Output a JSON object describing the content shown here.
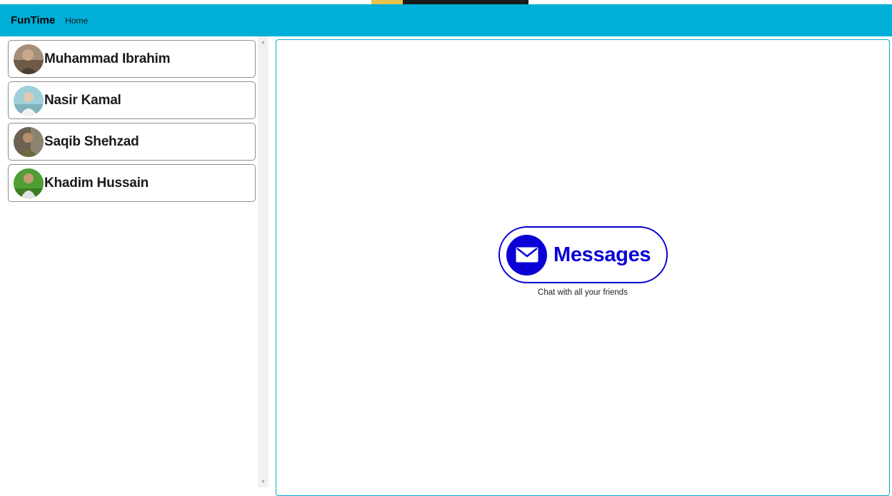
{
  "app": {
    "brand": "FunTime",
    "nav_home": "Home"
  },
  "contacts": [
    {
      "name": "Muhammad Ibrahim",
      "avatar_colors": [
        "#7b6a5a",
        "#c9b7a3"
      ]
    },
    {
      "name": "Nasir Kamal",
      "avatar_colors": [
        "#8fc3cf",
        "#e9eef0"
      ]
    },
    {
      "name": "Saqib Shehzad",
      "avatar_colors": [
        "#5a5040",
        "#b2a58a"
      ]
    },
    {
      "name": "Khadim Hussain",
      "avatar_colors": [
        "#3f8f2a",
        "#c8e0b6"
      ]
    }
  ],
  "main": {
    "logo_text": "Messages",
    "logo_icon": "envelope-icon",
    "subtitle": "Chat with all your friends"
  },
  "colors": {
    "navbar": "#00afd8",
    "accent": "#0a00d6"
  }
}
